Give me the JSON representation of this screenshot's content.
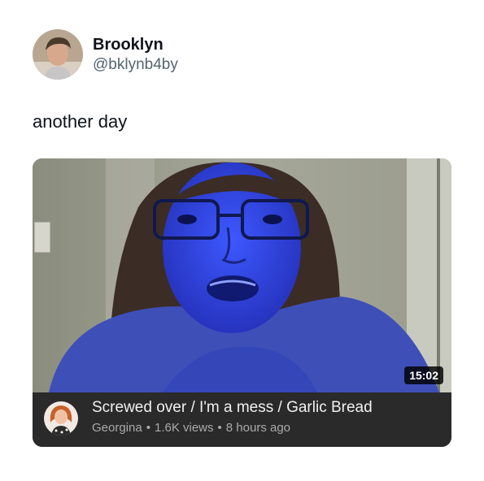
{
  "tweet": {
    "author": {
      "display_name": "Brooklyn",
      "handle": "@bklynb4by"
    },
    "text": "another day"
  },
  "video": {
    "duration": "15:02",
    "title": "Screwed over / I'm a mess / Garlic Bread",
    "channel": "Georgina",
    "separator": "•",
    "views": "1.6K views",
    "posted": "8 hours ago"
  },
  "colors": {
    "text_primary": "#0f1419",
    "text_secondary": "#536471",
    "card_background": "#2a2a2a",
    "thumbnail_tint": "#3a4ee0"
  }
}
